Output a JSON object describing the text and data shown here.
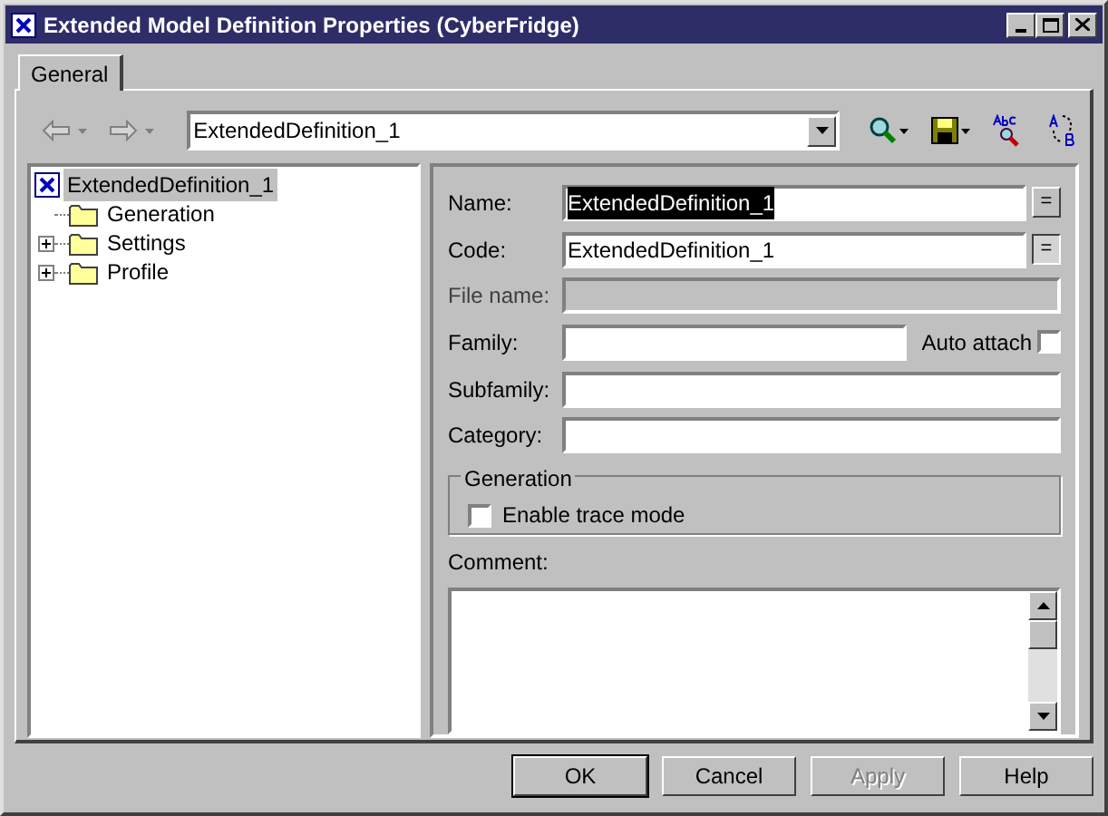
{
  "window": {
    "title": "Extended Model Definition Properties (CyberFridge)"
  },
  "tabs": [
    {
      "label": "General",
      "selected": true
    }
  ],
  "toolbar": {
    "back_disabled": true,
    "forward_disabled": true,
    "object_combo": "ExtendedDefinition_1"
  },
  "tree": [
    {
      "label": "ExtendedDefinition_1",
      "kind": "model",
      "selected": true,
      "children": [
        {
          "label": "Generation",
          "kind": "folder",
          "expandable": false,
          "selected": false
        },
        {
          "label": "Settings",
          "kind": "folder",
          "expandable": true,
          "selected": false
        },
        {
          "label": "Profile",
          "kind": "folder",
          "expandable": true,
          "selected": false
        }
      ]
    }
  ],
  "fields": [
    {
      "label": "Name:",
      "value": "ExtendedDefinition_1",
      "value_selected": true,
      "disabled": false,
      "equal_button": "=",
      "equal_pressed": false
    },
    {
      "label": "Code:",
      "value": "ExtendedDefinition_1",
      "value_selected": false,
      "disabled": false,
      "equal_button": "=",
      "equal_pressed": true
    },
    {
      "label": "File name:",
      "disabled": true
    },
    {
      "label": "Family:",
      "disabled": false,
      "auto_attach": {
        "label": "Auto attach",
        "checked": false
      }
    },
    {
      "label": "Subfamily:",
      "disabled": false
    },
    {
      "label": "Category:",
      "disabled": false
    }
  ],
  "generation": {
    "title": "Generation",
    "options": [
      {
        "label": "Enable trace mode",
        "checked": false
      }
    ]
  },
  "comment": {
    "label": "Comment:"
  },
  "buttons": [
    {
      "label": "OK",
      "default": true,
      "disabled": false
    },
    {
      "label": "Cancel",
      "default": false,
      "disabled": false
    },
    {
      "label": "Apply",
      "default": false,
      "disabled": true
    },
    {
      "label": "Help",
      "default": false,
      "disabled": false
    }
  ]
}
